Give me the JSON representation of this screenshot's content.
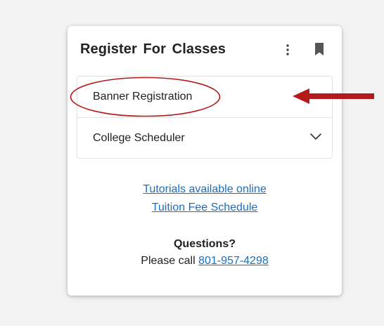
{
  "card": {
    "title": "Register For Classes",
    "icons": {
      "menu": "kebab-menu-icon",
      "bookmark": "bookmark-icon"
    }
  },
  "list": {
    "items": [
      {
        "label": "Banner Registration"
      },
      {
        "label": "College Scheduler",
        "icon": "chevron-down-icon"
      }
    ]
  },
  "links": {
    "tutorials": "Tutorials available online",
    "tuition": "Tuition Fee Schedule"
  },
  "questions": {
    "heading": "Questions?",
    "prefix": "Please call ",
    "phone": "801-957-4298"
  },
  "colors": {
    "link": "#1a6fc2",
    "annotation": "#b31b1b",
    "background": "#f3f3f3"
  }
}
